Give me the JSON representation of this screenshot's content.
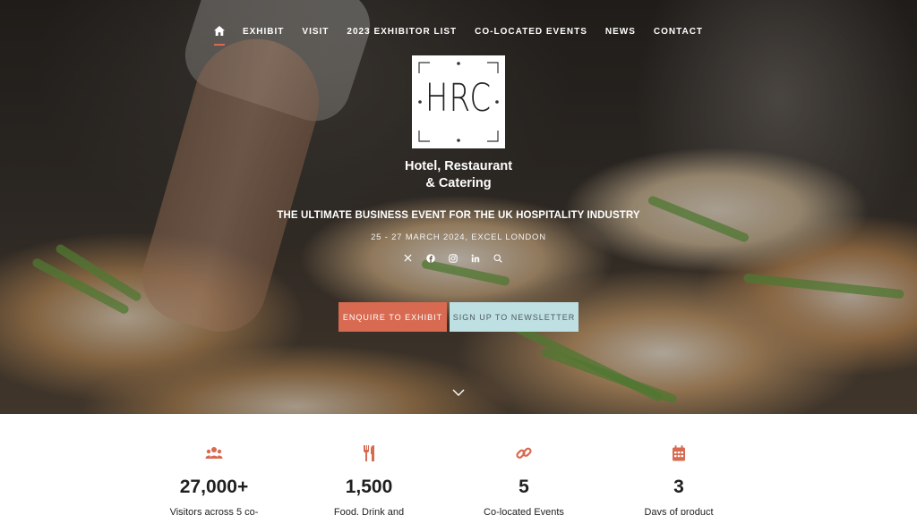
{
  "nav": {
    "home_icon": "home-icon",
    "items": [
      {
        "label": "EXHIBIT"
      },
      {
        "label": "VISIT"
      },
      {
        "label": "2023 EXHIBITOR LIST"
      },
      {
        "label": "CO-LOCATED EVENTS"
      },
      {
        "label": "NEWS"
      },
      {
        "label": "CONTACT"
      }
    ]
  },
  "logo": {
    "mark": "HRC",
    "line1": "Hotel, Restaurant",
    "line2": "& Catering"
  },
  "hero": {
    "tagline": "THE ULTIMATE BUSINESS EVENT FOR THE UK HOSPITALITY INDUSTRY",
    "dates": "25 - 27 MARCH 2024, EXCEL LONDON",
    "socials": [
      "x-icon",
      "facebook-icon",
      "instagram-icon",
      "linkedin-icon",
      "search-icon"
    ],
    "cta_exhibit": "ENQUIRE TO EXHIBIT",
    "cta_newsletter": "SIGN UP TO NEWSLETTER",
    "scroll_icon": "chevron-down-icon"
  },
  "stats": [
    {
      "icon": "users-icon",
      "value": "27,000+",
      "label": "Visitors across 5 co-"
    },
    {
      "icon": "cutlery-icon",
      "value": "1,500",
      "label": "Food, Drink and"
    },
    {
      "icon": "link-icon",
      "value": "5",
      "label": "Co-located Events"
    },
    {
      "icon": "calendar-icon",
      "value": "3",
      "label": "Days of product"
    }
  ],
  "colors": {
    "accent": "#d86a51",
    "newsletter_button": "#bfe0e3",
    "text_dark": "#1f1f1f"
  }
}
